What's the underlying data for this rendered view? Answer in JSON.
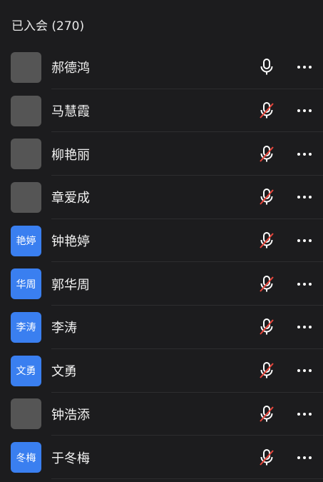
{
  "header": {
    "title": "已入会 (270)"
  },
  "participants": [
    {
      "name": "郝德鸿",
      "avatar_type": "photo",
      "avatar_icon": "photo-avatar-man",
      "mic": "on"
    },
    {
      "name": "马慧霞",
      "avatar_type": "photo",
      "avatar_icon": "photo-avatar-beach",
      "mic": "muted"
    },
    {
      "name": "柳艳丽",
      "avatar_type": "photo",
      "avatar_icon": "photo-avatar-garden",
      "mic": "muted"
    },
    {
      "name": "章爱成",
      "avatar_type": "photo",
      "avatar_icon": "photo-avatar-balloons",
      "mic": "muted"
    },
    {
      "name": "钟艳婷",
      "avatar_type": "text",
      "avatar_text": "艳婷",
      "mic": "muted"
    },
    {
      "name": "郭华周",
      "avatar_type": "text",
      "avatar_text": "华周",
      "mic": "muted"
    },
    {
      "name": "李涛",
      "avatar_type": "text",
      "avatar_text": "李涛",
      "mic": "muted"
    },
    {
      "name": "文勇",
      "avatar_type": "text",
      "avatar_text": "文勇",
      "mic": "muted"
    },
    {
      "name": "钟浩添",
      "avatar_type": "photo",
      "avatar_icon": "photo-avatar-girl",
      "mic": "muted"
    },
    {
      "name": "于冬梅",
      "avatar_type": "text",
      "avatar_text": "冬梅",
      "mic": "muted"
    }
  ],
  "colors": {
    "background": "#1c1c1e",
    "text_avatar": "#3a7ff0",
    "muted_slash": "#e8463c",
    "icon": "#ffffff"
  },
  "icons": {
    "mic_on": "microphone-icon",
    "mic_muted": "microphone-muted-icon",
    "more": "more-dots-icon"
  }
}
